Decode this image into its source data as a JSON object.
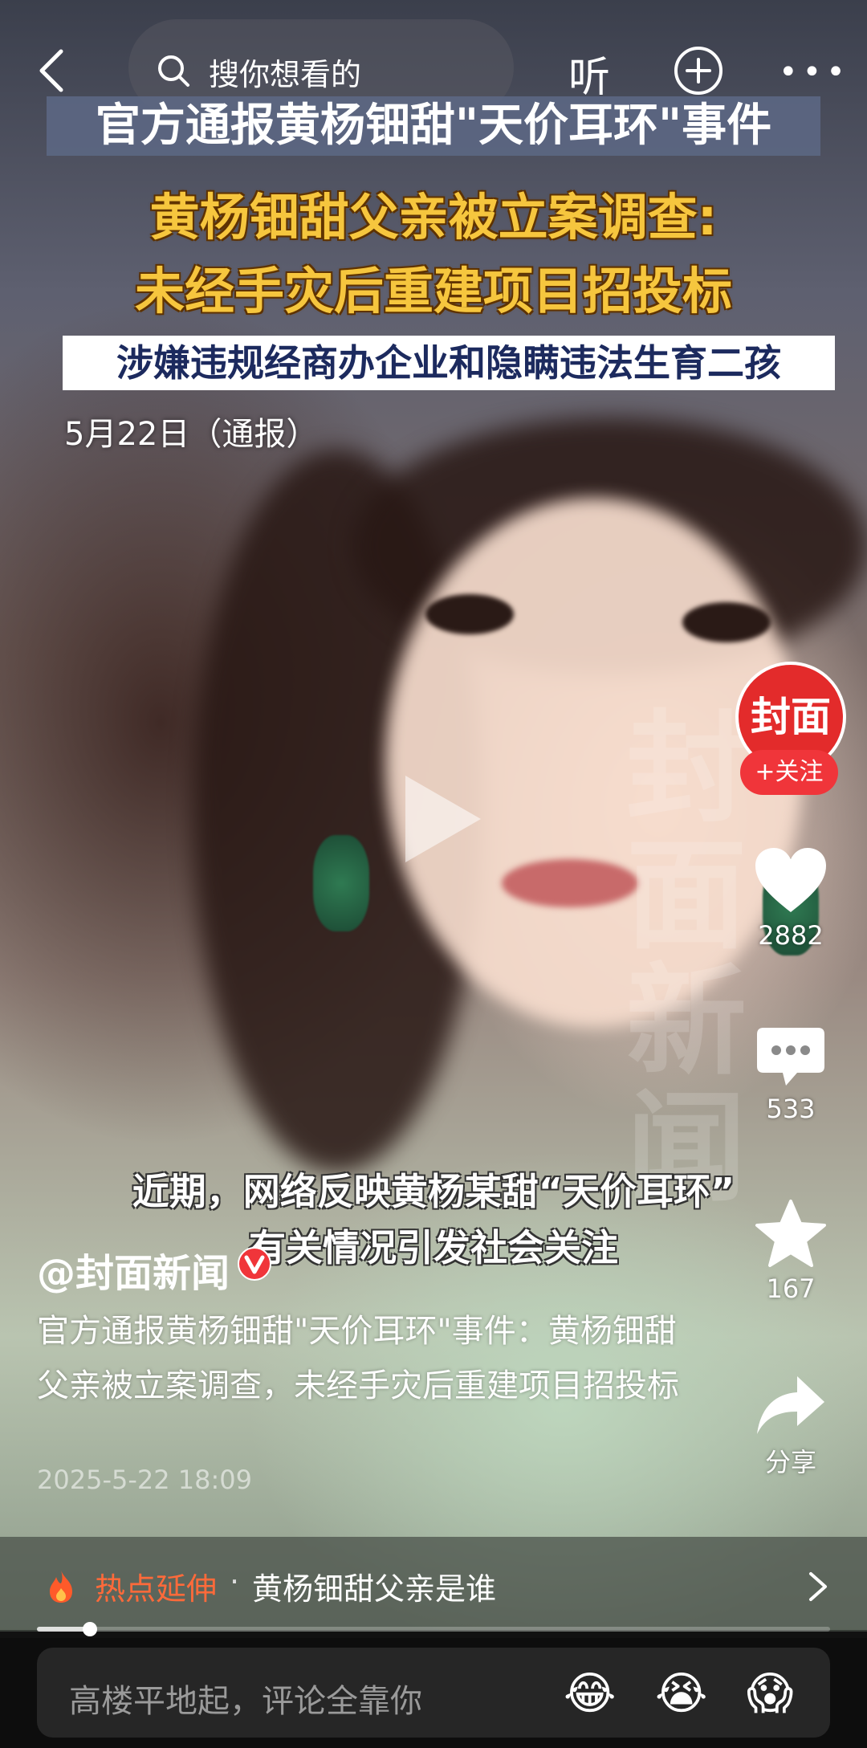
{
  "topbar": {
    "search_placeholder": "搜你想看的",
    "listen_label": "听"
  },
  "video": {
    "title_line": "官方通报黄杨钿甜\"天价耳环\"事件",
    "headline_line1": "黄杨钿甜父亲被立案调查:",
    "headline_line2": "未经手灾后重建项目招投标",
    "sub_line": "涉嫌违规经商办企业和隐瞒违法生育二孩",
    "date_note": "5月22日（通报）",
    "watermark": "封面新闻",
    "caption_line1": "近期，网络反映黄杨某甜“天价耳环”",
    "caption_line2": "有关情况引发社会关注"
  },
  "rail": {
    "avatar_text": "封面",
    "follow_label": "+关注",
    "likes": "2882",
    "comments": "533",
    "favorites": "167",
    "share_label": "分享"
  },
  "post": {
    "author": "@封面新闻",
    "description": "官方通报黄杨钿甜\"天价耳环\"事件：黄杨钿甜父亲被立案调查，未经手灾后重建项目招投标",
    "timestamp": "2025-5-22 18:09"
  },
  "hot_topic": {
    "label": "热点延伸",
    "separator": "·",
    "text": "黄杨钿甜父亲是谁"
  },
  "playback": {
    "progress": 0.067
  },
  "comment_bar": {
    "placeholder": "高楼平地起，评论全靠你",
    "emojis": [
      "😂",
      "😭",
      "😱"
    ]
  },
  "colors": {
    "accent_red": "#f0353a",
    "headline_yellow": "#f6c63e",
    "hot_orange": "#ff6a3a"
  }
}
